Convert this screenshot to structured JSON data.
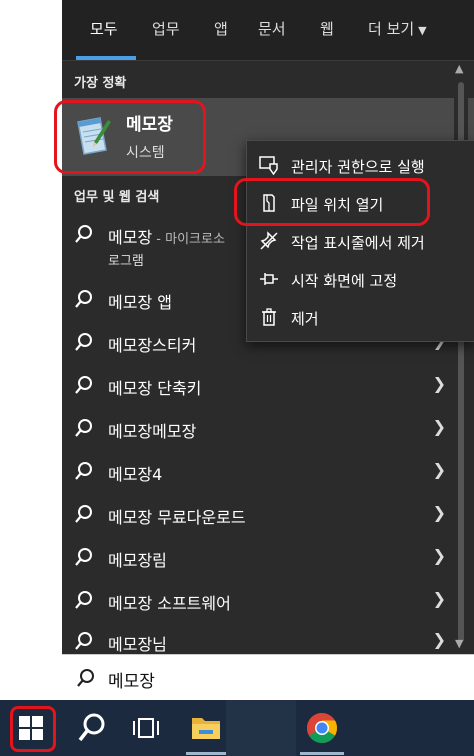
{
  "tabs": [
    {
      "label": "모두",
      "active": true
    },
    {
      "label": "업무"
    },
    {
      "label": "앱"
    },
    {
      "label": "문서"
    },
    {
      "label": "웹"
    },
    {
      "label": "더 보기"
    }
  ],
  "best_match": {
    "section_label": "가장 정확",
    "title": "메모장",
    "subtitle": "시스템",
    "icon": "notepad-icon"
  },
  "web_section": {
    "label": "업무 및 웹 검색",
    "first_result": {
      "text": "메모장",
      "suffix": " - 마이크로소",
      "line2": "로그램"
    },
    "results": [
      "메모장 앱",
      "메모장스티커",
      "메모장 단축키",
      "메모장메모장",
      "메모장4",
      "메모장 무료다운로드",
      "메모장림",
      "메모장 소프트웨어",
      "메모장님"
    ]
  },
  "context_menu": [
    {
      "label": "관리자 권한으로 실행",
      "icon": "shield-run-icon"
    },
    {
      "label": "파일 위치 열기",
      "icon": "folder-location-icon"
    },
    {
      "label": "작업 표시줄에서 제거",
      "icon": "unpin-icon"
    },
    {
      "label": "시작 화면에 고정",
      "icon": "pin-icon"
    },
    {
      "label": "제거",
      "icon": "trash-icon"
    }
  ],
  "search": {
    "value": "메모장"
  },
  "taskbar": {
    "items": [
      "start-icon",
      "search-icon",
      "task-view-icon",
      "file-explorer-icon",
      "chrome-icon"
    ]
  },
  "colors": {
    "accent": "#4aa0e6",
    "highlight": "#e3141b",
    "panel": "#2b2b2b",
    "taskbar": "#1b2a3e"
  }
}
